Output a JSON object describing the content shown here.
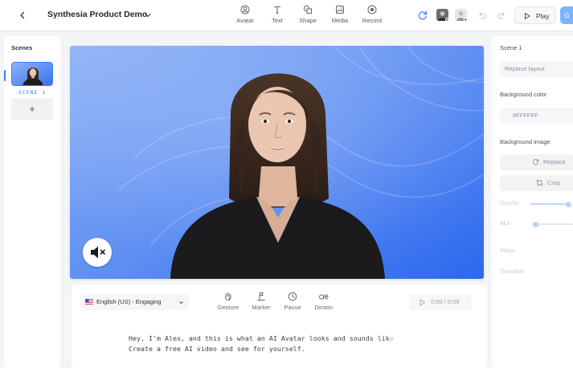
{
  "header": {
    "project_title": "Synthesia Product Demo",
    "tools": [
      {
        "label": "Avatar",
        "icon": "avatar-icon"
      },
      {
        "label": "Text",
        "icon": "text-icon"
      },
      {
        "label": "Shape",
        "icon": "shape-icon"
      },
      {
        "label": "Media",
        "icon": "media-icon"
      },
      {
        "label": "Record",
        "icon": "record-icon"
      }
    ],
    "play_label": "Play",
    "generate_label": "G"
  },
  "scenes": {
    "title": "Scenes",
    "items": [
      {
        "label": "SCENE 1"
      }
    ],
    "add_label": "+"
  },
  "script": {
    "language": "English (US) - Engaging",
    "tools": [
      {
        "label": "Gesture",
        "icon": "gesture-icon"
      },
      {
        "label": "Marker",
        "icon": "marker-icon"
      },
      {
        "label": "Pause",
        "icon": "pause-clock-icon"
      },
      {
        "label": "Diction",
        "icon": "diction-icon"
      }
    ],
    "time": "0:00 / 0:09",
    "line1": "Hey, I'm Alex, and this is what an AI Avatar looks and sounds lik",
    "line1_fade": "e",
    "line2": "Create a free AI video and see for yourself."
  },
  "right_panel": {
    "scene_title": "Scene 1",
    "replace_layout": "Replace layout",
    "bg_color_label": "Background color",
    "bg_color_value": "#FFFFFF",
    "bg_image_label": "Background image",
    "replace_label": "Replace",
    "crop_label": "Crop",
    "opacity_label": "Opacity",
    "opacity_value": 1.0,
    "blur_label": "Blur",
    "blur_value": 0.0,
    "music_label": "Music",
    "transition_label": "Transition"
  },
  "colors": {
    "accent": "#3b7cf5",
    "canvas_bg_top": "#8fb3f7",
    "canvas_bg_bottom": "#2f6ff0"
  }
}
